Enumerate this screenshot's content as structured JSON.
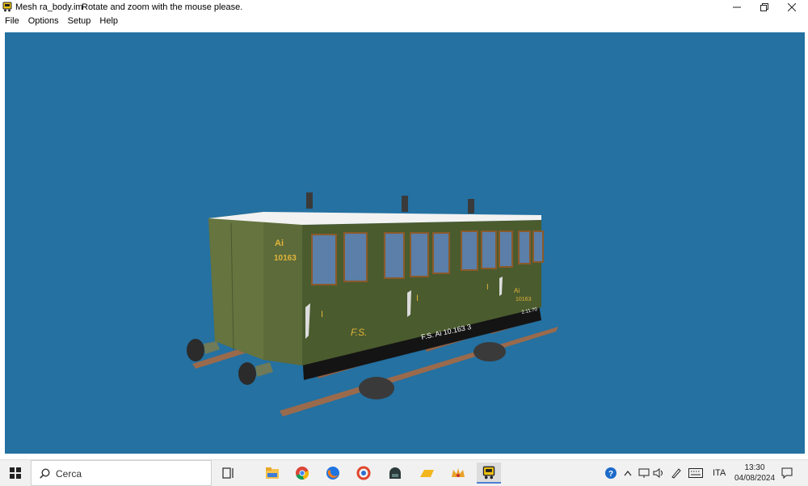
{
  "window": {
    "title": "Mesh ra_body.im",
    "message": "Rotate and zoom with the mouse please.",
    "icon": "train-icon",
    "controls": [
      "minimize-icon",
      "restore-icon",
      "close-icon"
    ]
  },
  "menu": {
    "items": [
      "File",
      "Options",
      "Setup",
      "Help"
    ]
  },
  "viewport": {
    "background": "#2471a2",
    "carriage": {
      "end_class": "Ai",
      "end_number": "10163",
      "side_class_mark": "I",
      "side_owner": "F.S.",
      "side_number": "F.S. Ai 10.163 3",
      "side_small_class": "Ai",
      "side_small_number": "10163",
      "side_date": "2.11.70",
      "body_color": "#4a5b2e",
      "roof_color": "#f2f2f2",
      "lettering_color": "#e0b43a"
    }
  },
  "taskbar": {
    "search_placeholder": "Cerca",
    "apps": [
      "task-view-icon",
      "file-explorer-icon",
      "chrome-icon",
      "firefox-icon",
      "ring-app-icon",
      "dome-app-icon",
      "yellow-app-icon",
      "crown-app-icon",
      "train-app-icon"
    ],
    "tray": {
      "language": "ITA",
      "time": "13:30",
      "date": "04/08/2024"
    }
  }
}
